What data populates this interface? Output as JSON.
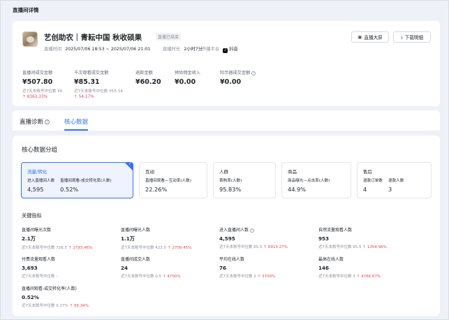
{
  "page": {
    "title": "直播间详情"
  },
  "header": {
    "title": "艺创助农｜青耘中国 秋收硕果",
    "status_tag": "直播已结束",
    "time_label": "直播时间",
    "time_value": "2025/07/06 18:53 ~ 2025/07/06 21:01",
    "duration_label": "直播时长",
    "duration_value": "2小时7分",
    "platform_label": "开播平台",
    "platform_value": "抖音",
    "platform_icon": "douyin-icon",
    "btn_screen": "直播大屏",
    "btn_download": "下载明细"
  },
  "summary_metrics": [
    {
      "label": "直播间成交金额",
      "value": "¥507.80",
      "sub": "近7天本账号中位数 ¥6",
      "change": "↑ 8363.33%"
    },
    {
      "label": "千次观看成交金额",
      "value": "¥85.31",
      "sub": "近7天本账号中位数 ¥55.34",
      "change": "↑ 54.17%"
    },
    {
      "label": "退款金额",
      "value": "¥60.20",
      "sub": "",
      "change": ""
    },
    {
      "label": "预估佣金收入",
      "value": "¥0.00",
      "sub": "",
      "change": ""
    },
    {
      "label": "际示器成交金额",
      "value": "¥0.00",
      "sub": "",
      "change": ""
    }
  ],
  "tabs": [
    {
      "label": "直播诊断",
      "active": false
    },
    {
      "label": "核心数据",
      "active": true
    }
  ],
  "core": {
    "section_title": "核心数据分组",
    "groups": [
      {
        "name": "流量/转化",
        "active": true,
        "cols": [
          {
            "label": "进入直播间人数",
            "value": "4,595"
          },
          {
            "label": "直播间观看-成交转化率(人数)",
            "value": "0.52%"
          }
        ]
      },
      {
        "name": "互动",
        "active": false,
        "cols": [
          {
            "label": "直播间观看—互动率(人数)",
            "value": "22.26%"
          }
        ]
      },
      {
        "name": "人群",
        "active": false,
        "cols": [
          {
            "label": "首购率(人数)",
            "value": "95.83%"
          }
        ]
      },
      {
        "name": "商品",
        "active": false,
        "cols": [
          {
            "label": "商品曝光—点击率(人数)",
            "value": "44.9%"
          }
        ]
      },
      {
        "name": "售后",
        "active": false,
        "cols": [
          {
            "label": "退款订单数",
            "value": "4"
          },
          {
            "label": "退款人数",
            "value": "3"
          }
        ]
      }
    ],
    "kpi_title": "关键指标",
    "kpis": [
      {
        "label": "直播间曝光次数",
        "value": "2.1万",
        "sub": "近7天本账号中位数 726.5",
        "change": "↑ 2793.46%"
      },
      {
        "label": "直播间曝光人数",
        "value": "1.1万",
        "sub": "近7天本账号中位数 423.5",
        "change": "↑ 2709.45%"
      },
      {
        "label": "进入直播间人数",
        "value": "4,595",
        "sub": "近7天本账号中位数 65.5",
        "change": "↑ 6915.27%"
      },
      {
        "label": "自然流量观看人数",
        "value": "953",
        "sub": "近7天本账号中位数 65.5",
        "change": "↑ 1354.96%"
      },
      {
        "label": "付费流量观看人数",
        "value": "3,693",
        "sub": "近7天本账号中位数 –",
        "change": ""
      },
      {
        "label": "直播间成交人数",
        "value": "24",
        "sub": "近7天本账号中位数 0.5",
        "change": "↑ 4700%"
      },
      {
        "label": "平均在线人数",
        "value": "76",
        "sub": "近7天本账号中位数 2",
        "change": "↑ 3700%"
      },
      {
        "label": "最高在线人数",
        "value": "146",
        "sub": "近7天本账号中位数 3",
        "change": "↑ 4766.67%"
      },
      {
        "label": "直播间观看-成交转化率(人数)",
        "value": "0.52%",
        "sub": "近7天本账号中位数 0.27%",
        "change": "↑ 95.34%"
      }
    ]
  }
}
